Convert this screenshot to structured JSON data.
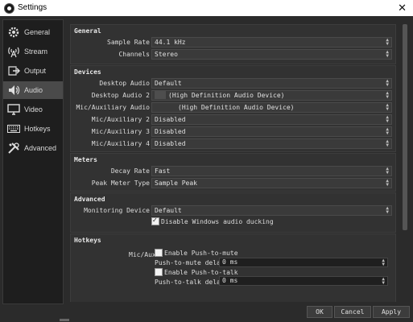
{
  "window": {
    "title": "Settings",
    "close_glyph": "✕"
  },
  "sidebar": {
    "items": [
      {
        "label": "General",
        "icon": "gear-icon"
      },
      {
        "label": "Stream",
        "icon": "antenna-icon"
      },
      {
        "label": "Output",
        "icon": "output-icon"
      },
      {
        "label": "Audio",
        "icon": "speaker-icon",
        "active": true
      },
      {
        "label": "Video",
        "icon": "monitor-icon"
      },
      {
        "label": "Hotkeys",
        "icon": "keyboard-icon"
      },
      {
        "label": "Advanced",
        "icon": "tools-icon"
      }
    ]
  },
  "general": {
    "title": "General",
    "sample_rate_label": "Sample Rate",
    "sample_rate_value": "44.1 kHz",
    "channels_label": "Channels",
    "channels_value": "Stereo"
  },
  "devices": {
    "title": "Devices",
    "rows": [
      {
        "label": "Desktop Audio",
        "value": "Default"
      },
      {
        "label": "Desktop Audio 2",
        "value": "(High Definition Audio Device)"
      },
      {
        "label": "Mic/Auxiliary Audio",
        "value": "(High Definition Audio Device)"
      },
      {
        "label": "Mic/Auxiliary 2",
        "value": "Disabled"
      },
      {
        "label": "Mic/Auxiliary 3",
        "value": "Disabled"
      },
      {
        "label": "Mic/Auxiliary 4",
        "value": "Disabled"
      }
    ]
  },
  "meters": {
    "title": "Meters",
    "decay_label": "Decay Rate",
    "decay_value": "Fast",
    "peak_label": "Peak Meter Type",
    "peak_value": "Sample Peak"
  },
  "advanced": {
    "title": "Advanced",
    "monitoring_label": "Monitoring Device",
    "monitoring_value": "Default",
    "ducking_label": "Disable Windows audio ducking",
    "ducking_checked": true
  },
  "hotkeys": {
    "title": "Hotkeys",
    "source_label": "Mic/Aux",
    "ptm_label": "Enable Push-to-mute",
    "ptm_delay_label": "Push-to-mute delay",
    "ptm_delay_value": "0 ms",
    "ptt_label": "Enable Push-to-talk",
    "ptt_delay_label": "Push-to-talk delay",
    "ptt_delay_value": "0 ms"
  },
  "buttons": {
    "ok": "OK",
    "cancel": "Cancel",
    "apply": "Apply"
  }
}
